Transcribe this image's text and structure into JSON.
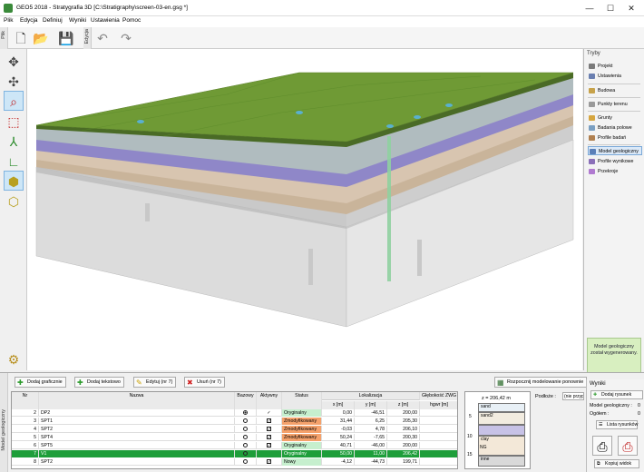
{
  "window": {
    "title": "GEO5 2018 - Stratygrafia 3D [C:\\Stratigraphy\\screen-03-en.gsg *]",
    "minimize": "—",
    "maximize": "☐",
    "close": "✕"
  },
  "menu": [
    "Plik",
    "Edycja",
    "Definiuj",
    "Wyniki",
    "Ustawienia",
    "Pomoc"
  ],
  "toolbar": {
    "side_label": "Plik",
    "group_label": "Edycja"
  },
  "right_panel": {
    "title": "Tryby",
    "items": [
      {
        "label": "Projekt",
        "color": "#7a7a7a"
      },
      {
        "label": "Ustawienia",
        "color": "#6a7fb0"
      },
      {
        "label": "Budowa",
        "color": "#c7a24a"
      },
      {
        "label": "Punkty terenu",
        "color": "#999999"
      },
      {
        "label": "Grunty",
        "color": "#d6a640"
      },
      {
        "label": "Badania polowe",
        "color": "#7a9fc2"
      },
      {
        "label": "Profile badań",
        "color": "#b08050"
      },
      {
        "label": "Model geologiczny",
        "color": "#5a7fb8"
      },
      {
        "label": "Profile wynikowe",
        "color": "#8a6fb8"
      },
      {
        "label": "Przekroje",
        "color": "#b07ad0"
      }
    ],
    "status_text": "Model geologiczny został wygenerowany."
  },
  "bottom": {
    "side_label": "Model geologiczny",
    "buttons": {
      "add_graphic": "Dodaj graficznie",
      "add_text": "Dodaj tekstowo",
      "edit": "Edytuj (nr 7)",
      "remove": "Usuń (nr 7)",
      "remodel": "Rozpocznij modelowanie ponownie"
    },
    "table": {
      "headers": {
        "nr": "Nr",
        "name": "Nazwa",
        "base": "Bazowy",
        "active": "Aktywny",
        "status": "Status",
        "location": "Lokalizacja",
        "x": "x [m]",
        "y": "y [m]",
        "z": "z [m]",
        "depth": "Głębokość ZWG",
        "depth_unit": "hgwr [m]"
      },
      "rows": [
        {
          "nr": "2",
          "name": "DP2",
          "base": "radio-on",
          "active": "tick",
          "status": "Oryginalny",
          "st": "orig",
          "x": "0,00",
          "y": "-46,51",
          "z": "200,00",
          "d": ""
        },
        {
          "nr": "3",
          "name": "SPT1",
          "base": "radio",
          "active": "check",
          "status": "Zmodyfikowany",
          "st": "mod",
          "x": "31,44",
          "y": "6,25",
          "z": "205,30",
          "d": ""
        },
        {
          "nr": "4",
          "name": "SPT2",
          "base": "radio",
          "active": "check",
          "status": "Zmodyfikowany",
          "st": "mod",
          "x": "-0,03",
          "y": "4,78",
          "z": "206,10",
          "d": ""
        },
        {
          "nr": "5",
          "name": "SPT4",
          "base": "radio",
          "active": "check",
          "status": "Zmodyfikowany",
          "st": "mod",
          "x": "50,24",
          "y": "-7,65",
          "z": "200,30",
          "d": ""
        },
        {
          "nr": "6",
          "name": "SPT5",
          "base": "radio",
          "active": "check",
          "status": "Oryginalny",
          "st": "orig",
          "x": "40,71",
          "y": "-46,00",
          "z": "200,00",
          "d": ""
        },
        {
          "nr": "7",
          "name": "V1",
          "base": "radio",
          "active": "",
          "status": "Oryginalny",
          "st": "orig",
          "x": "50,00",
          "y": "11,00",
          "z": "206,42",
          "d": ""
        },
        {
          "nr": "8",
          "name": "SPT2",
          "base": "radio",
          "active": "check",
          "status": "Nowy",
          "st": "new",
          "x": "-4,12",
          "y": "-44,73",
          "z": "199,71",
          "d": ""
        }
      ]
    },
    "profile": {
      "z_label": "z = 206,42 m",
      "ticks": [
        "5",
        "10",
        "15"
      ],
      "layers": [
        "sand",
        "sand2",
        "clay",
        "NG",
        "inne"
      ]
    },
    "subsoil_label": "Podłoże :",
    "subsoil_value": "(nie przyp",
    "results": {
      "title": "Wyniki",
      "add_drawing": "Dodaj rysunek",
      "model_label": "Model geologiczny :",
      "model_value": "0",
      "total_label": "Ogółem :",
      "total_value": "0",
      "list_drawings": "Lista rysunków",
      "copy_view": "Kopiuj widok"
    }
  }
}
